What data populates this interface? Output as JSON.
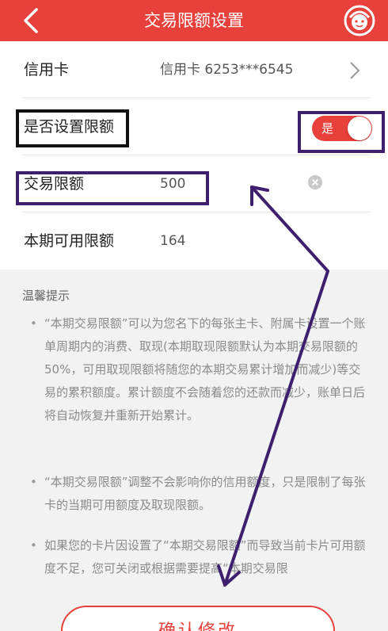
{
  "nav": {
    "title": "交易限额设置"
  },
  "rows": {
    "card": {
      "label": "信用卡",
      "value": "信用卡 6253***6545"
    },
    "set_limit": {
      "label": "是否设置限额",
      "toggle_label": "是",
      "enabled": true
    },
    "limit": {
      "label": "交易限额",
      "value": "500"
    },
    "available": {
      "label": "本期可用限额",
      "value": "164"
    }
  },
  "tips": {
    "title": "温馨提示",
    "bullet": "•",
    "items": [
      "“本期交易限额”可以为您名下的每张主卡、附属卡设置一个账单周期内的消费、取现(本期取现限额默认为本期交易限额的50%，可用取现限额将随您的本期交易累计增加而减少)等交易的累积额度。累计额度不会随着您的还款而减少，账单日后将自动恢复并重新开始累计。",
      "“本期交易限额”调整不会影响你的信用额度，只是限制了每张卡的当期可用额度及取现限额。",
      "如果您的卡片因设置了“本期交易限额”而导致当前卡片可用额度不足，您可关闭或根据需要提高“本期交易限"
    ]
  },
  "confirm_label": "确认修改",
  "colors": {
    "brand": "#e8403a",
    "annotation_purple": "#3d1f6e",
    "annotation_black": "#111111"
  },
  "icons": {
    "back": "back-arrow-icon",
    "service": "customer-service-icon",
    "chevron": "chevron-right-icon",
    "clear": "clear-icon"
  }
}
